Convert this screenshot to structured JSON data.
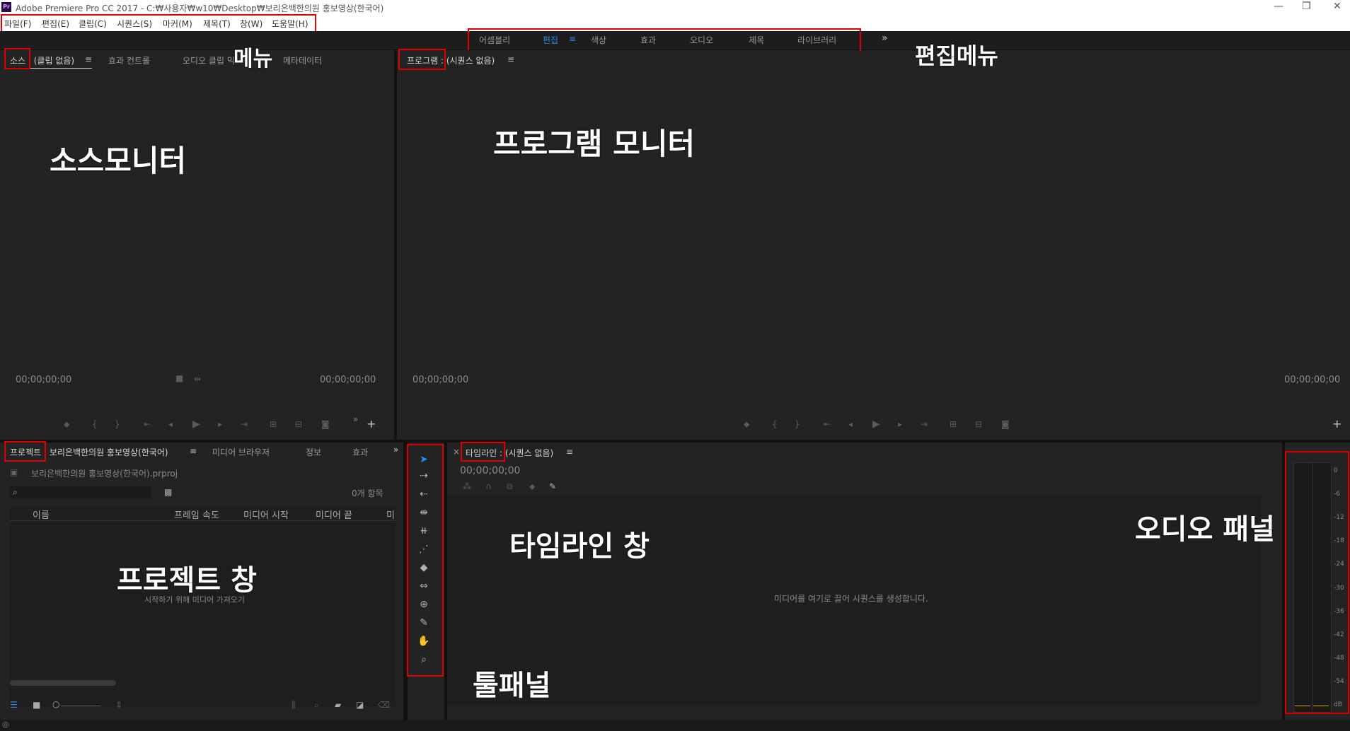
{
  "window": {
    "app_icon": "Pr",
    "title": "Adobe Premiere Pro CC 2017 - C:₩사용자₩w10₩Desktop₩보리은백한의원 홍보영상(한국어)",
    "minimize": "—",
    "restore": "❐",
    "close": "✕"
  },
  "menu": {
    "items": [
      "파일(F)",
      "편집(E)",
      "클립(C)",
      "시퀀스(S)",
      "마커(M)",
      "제목(T)",
      "창(W)",
      "도움말(H)"
    ]
  },
  "workspaces": {
    "items": [
      "어셈블리",
      "편집",
      "색상",
      "효과",
      "오디오",
      "제목",
      "라이브러리"
    ],
    "active": "편집",
    "menu_glyph": "≡",
    "more_glyph": "»"
  },
  "source_panel": {
    "tabs": [
      "소스 : (클립 없음)",
      "효과 컨트롤",
      "오디오 클립 믹",
      "메타데이터"
    ],
    "menu_glyph": "≡",
    "timecode_left": "00;00;00;00",
    "timecode_right": "00;00;00;00",
    "add_glyph": "+",
    "more_glyph": "»"
  },
  "program_panel": {
    "tab": "프로그램 : (시퀀스 없음)",
    "menu_glyph": "≡",
    "timecode_left": "00;00;00;00",
    "timecode_right": "00;00;00;00",
    "add_glyph": "+"
  },
  "project_panel": {
    "tabs": [
      "프로젝트 : 보리은백한의원 홍보영상(한국어)",
      "미디어 브라우저",
      "정보",
      "효과"
    ],
    "menu_glyph": "≡",
    "more_glyph": "»",
    "file_name": "보리은백한의원 홍보영상(한국어).prproj",
    "search_placeholder": "",
    "item_count": "0개 항목",
    "columns": [
      "이름",
      "프레임 속도",
      "미디어 시작",
      "미디어 끝",
      "미"
    ],
    "empty_hint": "시작하기 위해 미디어 가져오기"
  },
  "timeline_panel": {
    "close_glyph": "×",
    "tab": "타임라인 : (시퀀스 없음)",
    "menu_glyph": "≡",
    "timecode": "00;00;00;00",
    "empty_hint": "미디어를 여기로 끌어 시퀀스를 생성합니다."
  },
  "audio_meter": {
    "scale": [
      "0",
      "-6",
      "-12",
      "-18",
      "-24",
      "-30",
      "-36",
      "-42",
      "-48",
      "-54",
      "dB"
    ]
  },
  "annotations": {
    "menu": "메뉴",
    "edit_menu": "편집메뉴",
    "source_monitor": "소스모니터",
    "program_monitor": "프로그램 모니터",
    "project_window": "프로젝트 창",
    "timeline_window": "타임라인 창",
    "tool_panel": "툴패널",
    "audio_panel": "오디오 패널"
  },
  "colors": {
    "accent": "#2d8ceb",
    "annotation_box": "#e00000",
    "panel_bg": "#232323",
    "meter_level": "#d4a017"
  }
}
